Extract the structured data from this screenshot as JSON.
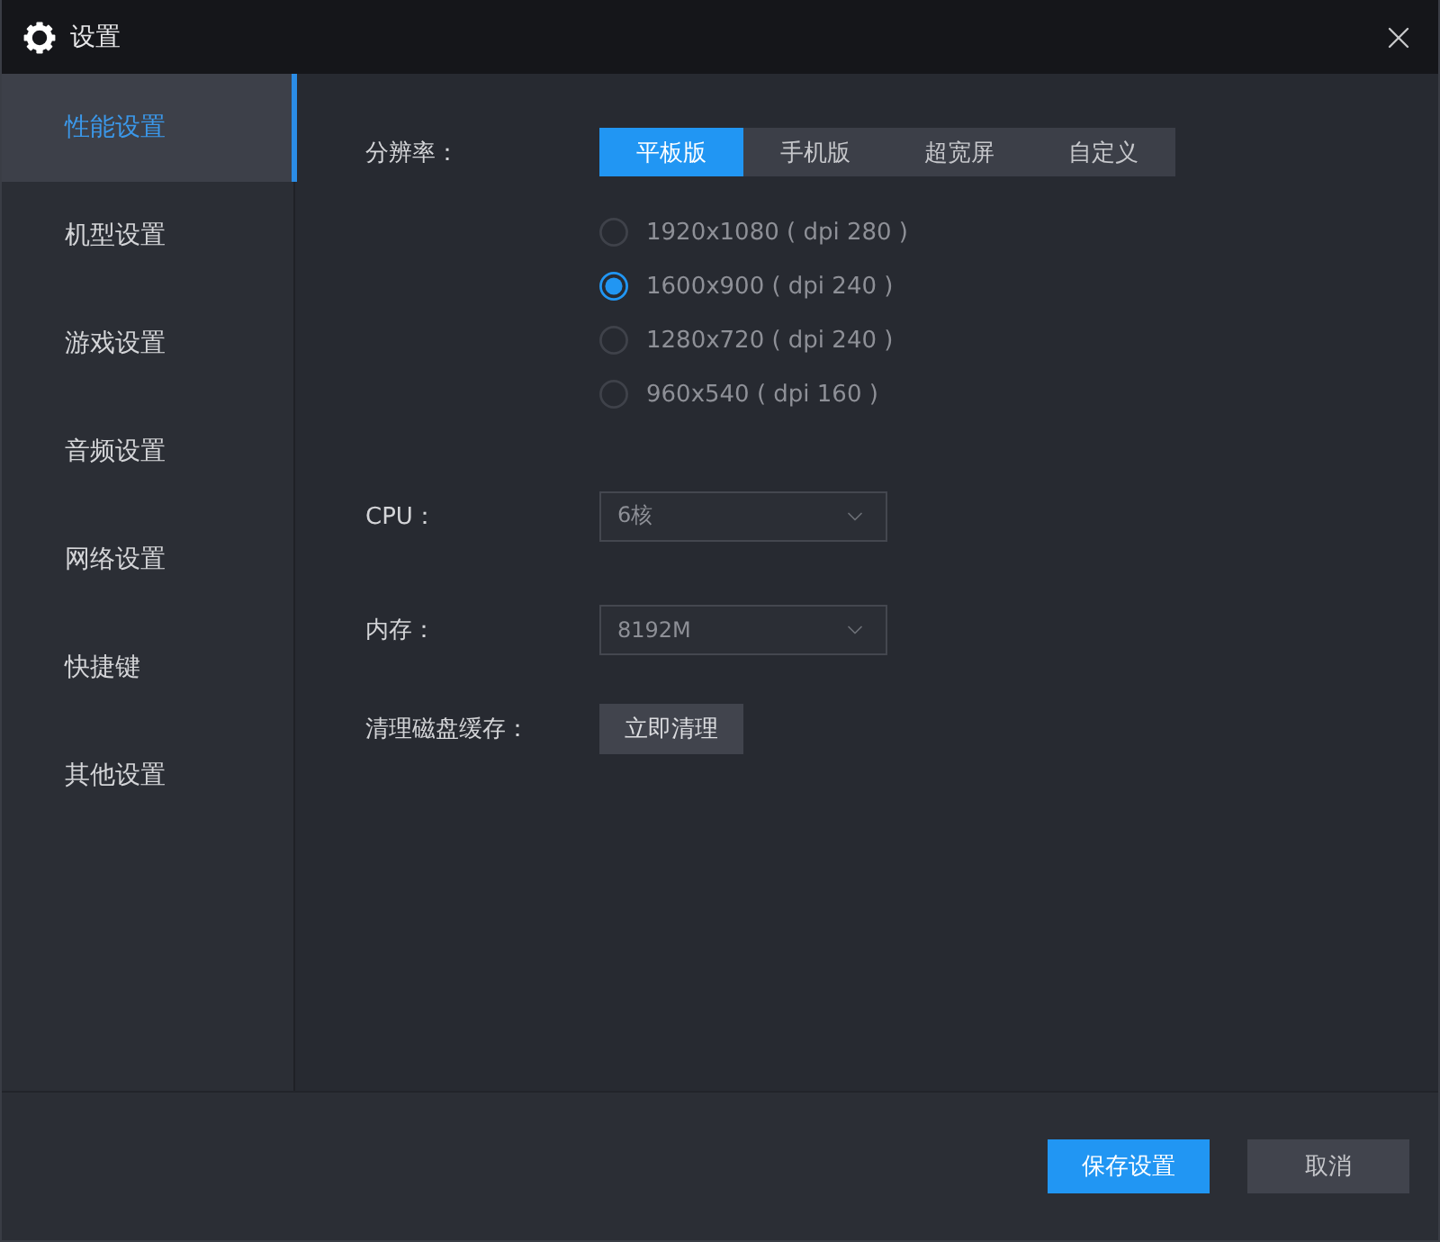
{
  "window": {
    "title": "设置"
  },
  "sidebar": {
    "items": [
      {
        "label": "性能设置",
        "selected": true
      },
      {
        "label": "机型设置",
        "selected": false
      },
      {
        "label": "游戏设置",
        "selected": false
      },
      {
        "label": "音频设置",
        "selected": false
      },
      {
        "label": "网络设置",
        "selected": false
      },
      {
        "label": "快捷键",
        "selected": false
      },
      {
        "label": "其他设置",
        "selected": false
      }
    ]
  },
  "resolution": {
    "label": "分辨率：",
    "tabs": [
      {
        "label": "平板版",
        "selected": true
      },
      {
        "label": "手机版",
        "selected": false
      },
      {
        "label": "超宽屏",
        "selected": false
      },
      {
        "label": "自定义",
        "selected": false
      }
    ],
    "options": [
      {
        "label": "1920x1080 ( dpi 280 )",
        "selected": false
      },
      {
        "label": "1600x900 ( dpi 240 )",
        "selected": true
      },
      {
        "label": "1280x720 ( dpi 240 )",
        "selected": false
      },
      {
        "label": "960x540 ( dpi 160 )",
        "selected": false
      }
    ]
  },
  "cpu": {
    "label": "CPU：",
    "value": "6核"
  },
  "memory": {
    "label": "内存：",
    "value": "8192M"
  },
  "clear_cache": {
    "label": "清理磁盘缓存：",
    "button": "立即清理"
  },
  "footer": {
    "buttons": [
      {
        "label": "保存设置",
        "kind": "primary"
      },
      {
        "label": "取消",
        "kind": "secondary"
      }
    ]
  }
}
